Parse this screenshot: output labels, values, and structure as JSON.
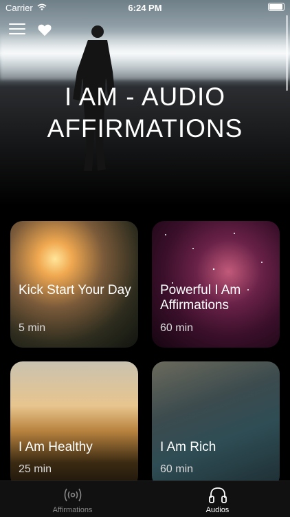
{
  "status": {
    "carrier": "Carrier",
    "time": "6:24 PM"
  },
  "topbar": {
    "menu_icon": "hamburger-menu-icon",
    "favorite_icon": "heart-icon"
  },
  "hero": {
    "title": "I AM - AUDIO AFFIRMATIONS"
  },
  "cards": [
    {
      "title": "Kick Start Your Day",
      "duration": "5 min"
    },
    {
      "title": "Powerful I Am Affirmations",
      "duration": "60 min"
    },
    {
      "title": "I Am Healthy",
      "duration": "25 min"
    },
    {
      "title": "I Am Rich",
      "duration": "60 min"
    }
  ],
  "tabs": [
    {
      "label": "Affirmations",
      "icon": "broadcast-icon",
      "selected": false
    },
    {
      "label": "Audios",
      "icon": "headphones-icon",
      "selected": true
    }
  ]
}
